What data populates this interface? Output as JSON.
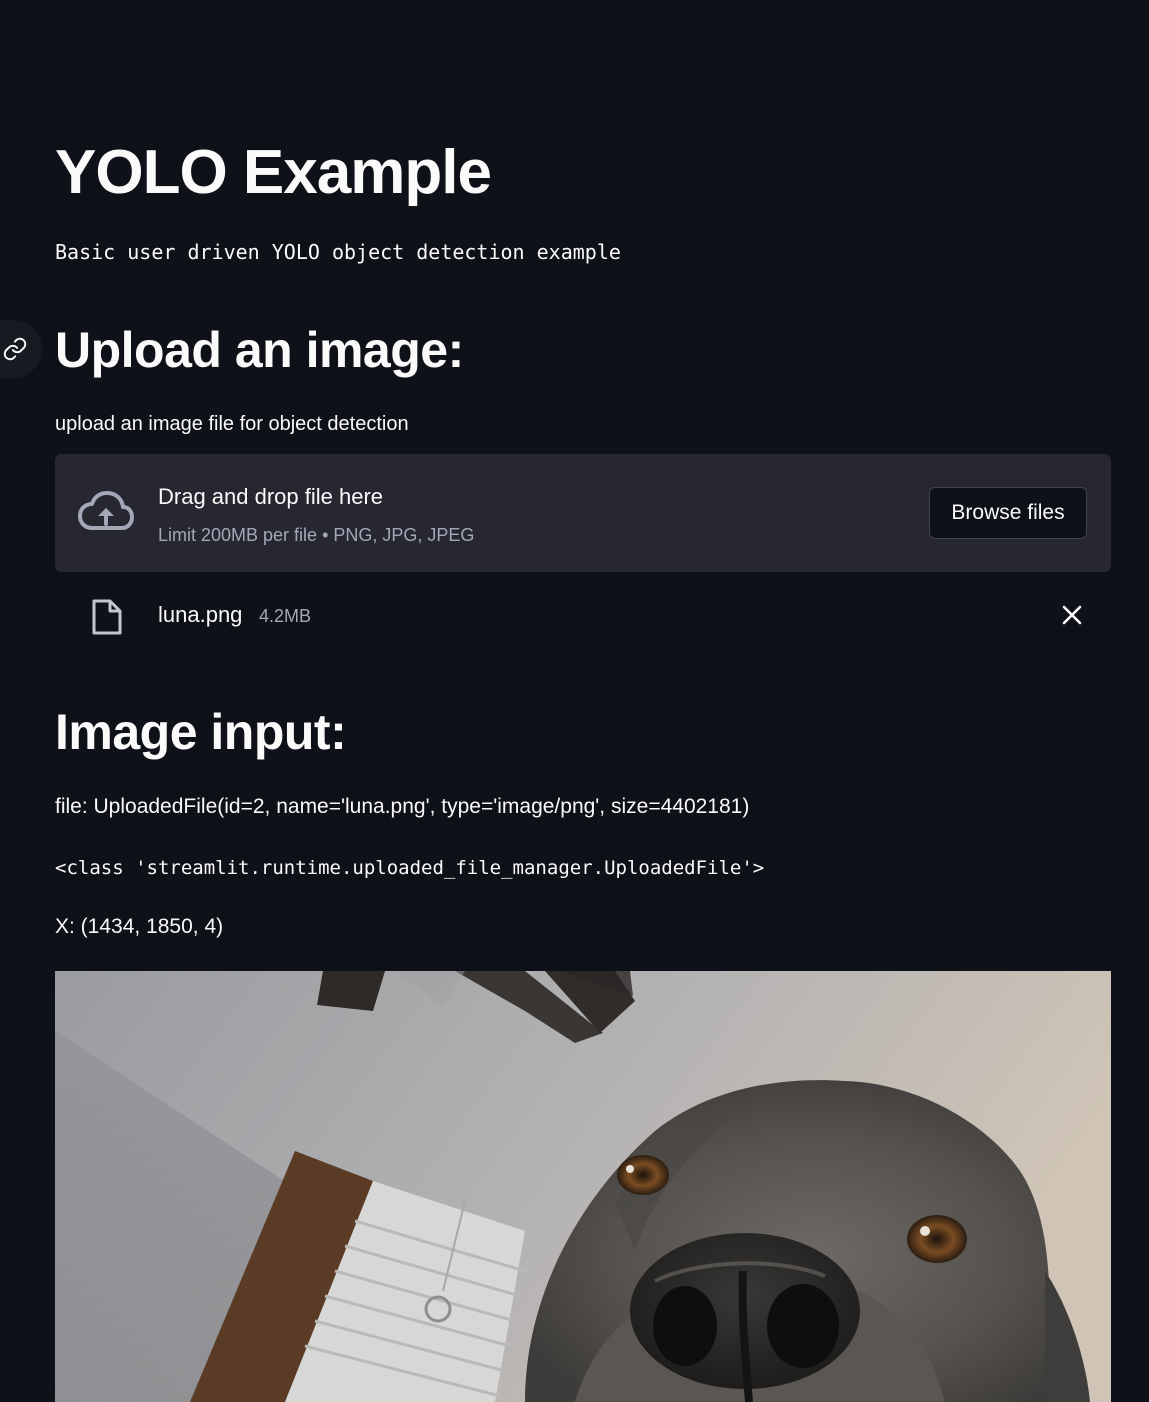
{
  "header": {
    "title": "YOLO Example",
    "subtitle": "Basic user driven YOLO object detection example"
  },
  "upload": {
    "heading": "Upload an image:",
    "label": "upload an image file for object detection",
    "dropzone": {
      "title": "Drag and drop file here",
      "limit": "Limit 200MB per file • PNG, JPG, JPEG",
      "browse_label": "Browse files"
    },
    "file": {
      "name": "luna.png",
      "size": "4.2MB"
    }
  },
  "image_input": {
    "heading": "Image input:",
    "file_repr": "file: UploadedFile(id=2, name='luna.png', type='image/png', size=4402181)",
    "class_repr": "<class 'streamlit.runtime.uploaded_file_manager.UploadedFile'>",
    "shape_repr": "X: (1434, 1850, 4)"
  },
  "icons": {
    "anchor": "link-icon",
    "upload": "cloud-upload-icon",
    "file": "file-icon",
    "remove": "close-icon"
  },
  "colors": {
    "background": "#0e1117",
    "dropzone": "#262730",
    "text": "#fafafa",
    "muted_text": "#a3a8b8"
  }
}
